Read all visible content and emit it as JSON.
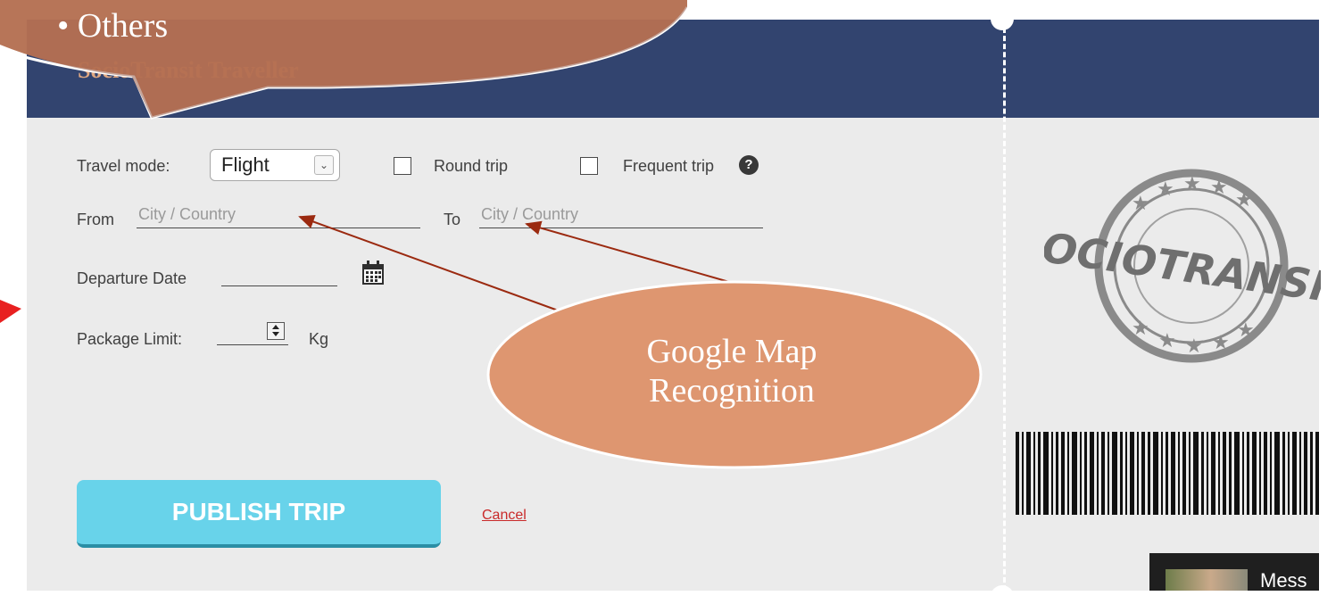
{
  "app": {
    "brand": "SocioTransit Traveller"
  },
  "form": {
    "travel_mode_label": "Travel mode:",
    "travel_mode_value": "Flight",
    "round_trip_label": "Round trip",
    "frequent_trip_label": "Frequent trip",
    "help_symbol": "?",
    "from_label": "From",
    "from_placeholder": "City / Country",
    "to_label": "To",
    "to_placeholder": "City / Country",
    "departure_label": "Departure Date",
    "package_label": "Package Limit:",
    "package_unit": "Kg"
  },
  "actions": {
    "publish_label": "PUBLISH TRIP",
    "cancel_label": "Cancel"
  },
  "stamp": {
    "text": "SOCIOTRANSIT"
  },
  "message": {
    "label": "Mess"
  },
  "annotations": {
    "bullet_text": "•   Others",
    "oval_line1": "Google Map",
    "oval_line2": "Recognition"
  },
  "colors": {
    "header": "#32446f",
    "brand": "#e0a882",
    "callout_dark": "#8e4c36",
    "callout_light": "#de9670",
    "arrow": "#9b2a10",
    "publish": "#68d3ea",
    "cancel": "#c92a2a"
  },
  "icons": [
    "calendar-icon",
    "help-icon",
    "chevron-down-icon",
    "stepper-icon",
    "barcode"
  ]
}
